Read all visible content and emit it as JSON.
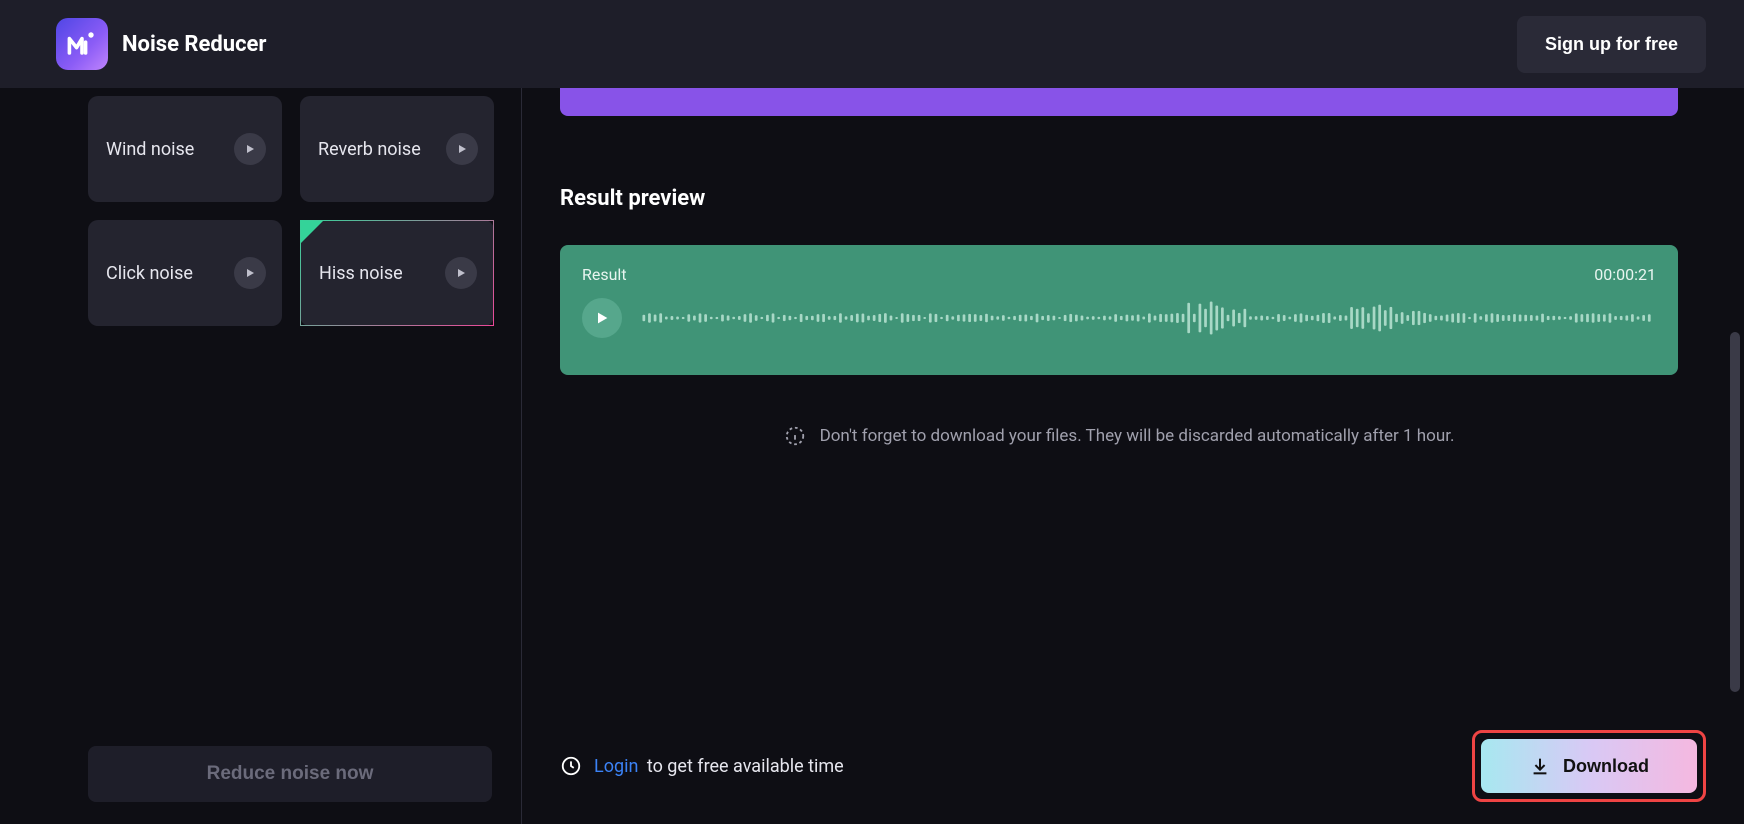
{
  "header": {
    "title": "Noise Reducer",
    "signup_label": "Sign up for free"
  },
  "noise_tiles": [
    {
      "label": "Wind noise",
      "selected": false
    },
    {
      "label": "Reverb noise",
      "selected": false
    },
    {
      "label": "Click noise",
      "selected": false
    },
    {
      "label": "Hiss noise",
      "selected": true
    }
  ],
  "reduce_button_label": "Reduce noise now",
  "result": {
    "section_title": "Result preview",
    "track_label": "Result",
    "duration": "00:00:21"
  },
  "note_text": "Don't forget to download your files. They will be discarded automatically after 1 hour.",
  "footer": {
    "login_label": "Login",
    "login_rest": "to get free available time",
    "download_label": "Download"
  }
}
